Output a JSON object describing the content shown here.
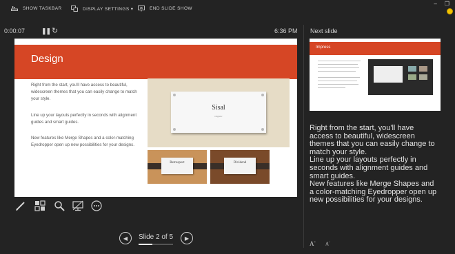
{
  "toolbar": {
    "show_taskbar": "SHOW TASKBAR",
    "display_settings": "DISPLAY SETTINGS ▾",
    "end_slide_show": "END SLIDE SHOW"
  },
  "window_controls": {
    "minimize": "–",
    "restore": "❐"
  },
  "presenter": {
    "elapsed": "0:00:07",
    "clock": "6:36 PM",
    "next_slide_label": "Next slide"
  },
  "current_slide": {
    "title": "Design",
    "paragraphs": [
      "Right from the start, you'll have access to beautiful, widescreen themes that you can easily change to match your style.",
      "Line up your layouts perfectly in seconds with alignment guides and smart guides.",
      "New features like Merge Shapes and a color-matching Eyedropper open up new possibilities for your designs."
    ],
    "theme_cards": [
      {
        "name": "Sisal",
        "subtitle": "Organic"
      },
      {
        "name": "Retrospect"
      },
      {
        "name": "Dividend"
      }
    ],
    "colors": {
      "accent": "#d64625",
      "background": "#ffffff"
    }
  },
  "next_slide": {
    "title": "Impress"
  },
  "notes": [
    "Right from the start, you'll have access to beautiful, widescreen themes that you can easily change to match your style.",
    "Line up your layouts perfectly in seconds with alignment guides and smart guides.",
    "New features like Merge Shapes and a color-matching Eyedropper open up new possibilities for your designs."
  ],
  "navigation": {
    "counter": "Slide 2 of 5",
    "progress_fraction": 0.4
  },
  "font_controls": {
    "increase": "A",
    "decrease": "A"
  },
  "icons": [
    "taskbar-icon",
    "display-settings-icon",
    "end-show-icon",
    "pause-icon",
    "restart-icon",
    "pen-icon",
    "all-slides-icon",
    "zoom-icon",
    "black-screen-icon",
    "more-options-icon",
    "prev-slide-icon",
    "next-slide-icon",
    "smiley-icon"
  ]
}
